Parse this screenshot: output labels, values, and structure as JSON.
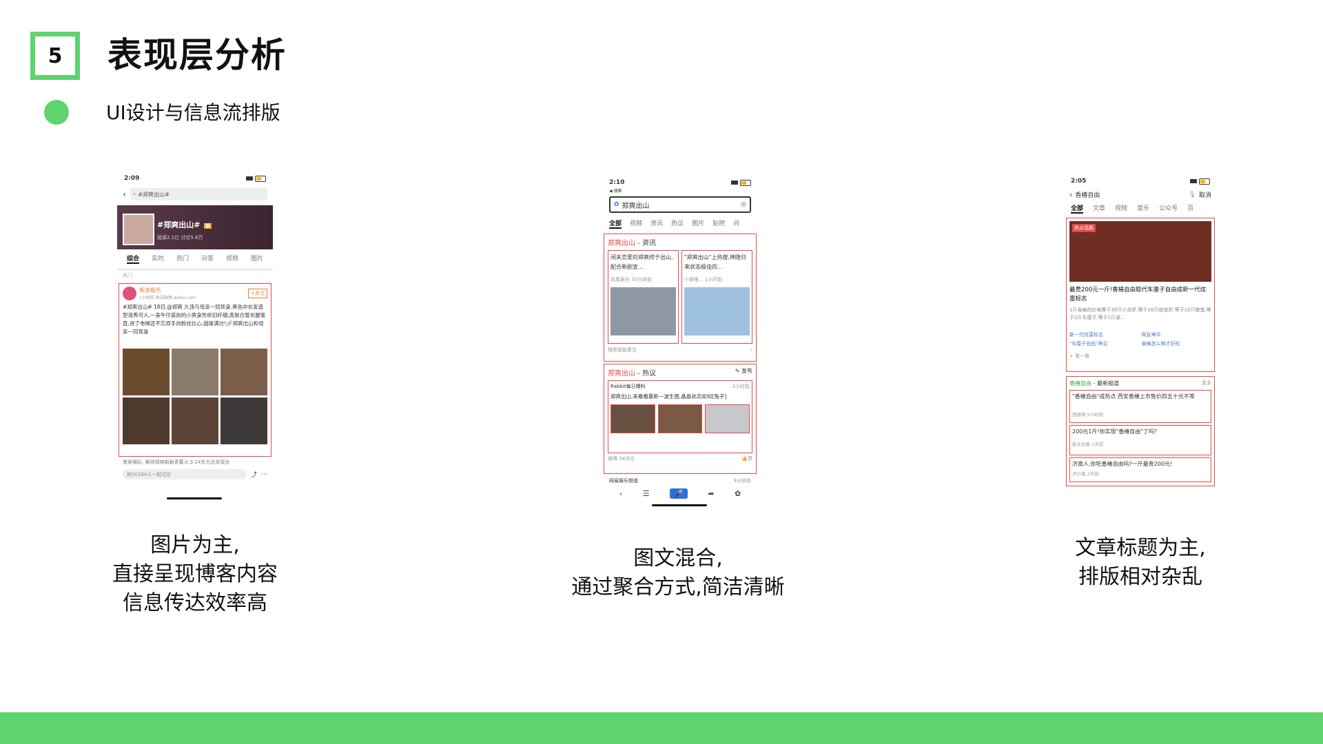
{
  "slide": {
    "number": "5",
    "title": "表现层分析",
    "subtitle": "UI设计与信息流排版"
  },
  "captions": {
    "left": [
      "图片为主,",
      "直接呈现博客内容",
      "信息传达效率高"
    ],
    "middle": [
      "图文混合,",
      "通过聚合方式,简洁清晰"
    ],
    "right": [
      "文章标题为主,",
      "排版相对杂乱"
    ]
  },
  "colors": {
    "accent": "#5fd36d",
    "highlight_red": "#e24a4a"
  },
  "phone_weibo": {
    "time": "2:09",
    "search": "#郑爽出山#",
    "topic_title": "#郑爽出山#",
    "topic_badge": "新",
    "topic_stats": "阅读2.1亿  讨论5.6万",
    "tabs": [
      "综合",
      "实时",
      "热门",
      "问答",
      "视频",
      "图片"
    ],
    "section": "热门",
    "poster": "新浪娱乐",
    "post_meta": "1小时前  来自微博 weibo.com",
    "follow": "+关注",
    "post_text": "#郑爽出山# 18日,@郑爽 久违与母亲一同现身,黑色中长发造型清秀可人,一身牛仔装扮的小爽身形依旧纤细,皮肤白皙长腿笔直,进了电梯还不忘双手向粉丝比心,甜度满分!🔗郑爽出山和母亲一同现身",
    "footer_line": "卷发喵砬: 期待郑爽新剧青春斗,3.24东方北京双台",
    "comment_placeholder": "和50184人一起讨论"
  },
  "phone_baidu": {
    "time": "2:10",
    "back_label": "◀ 搜索",
    "query": "郑爽出山",
    "tabs": [
      "全部",
      "视频",
      "资讯",
      "热议",
      "图片",
      "贴吧",
      "问"
    ],
    "news_title": "郑爽出山",
    "news_suffix": " - 资讯",
    "news_items": [
      {
        "title": "闭关恋爱的郑爽终于出山,配合新剧宣...",
        "source": "凤凰娱乐  35分钟前"
      },
      {
        "title": "\"郑爽出山\"上热搜,神隐归来状态极佳的...",
        "source": "小爱眼...  1小时前"
      }
    ],
    "news_more": "搜索智能聚合",
    "hot_title": "郑爽出山",
    "hot_suffix": " - 热议",
    "hot_publish": "发布",
    "hot_user": "Rabbit每日爆料",
    "hot_time": "2小时前",
    "hot_text": "郑爽出山,来看看最新一波生图,晶晶状态如何[兔子]",
    "hot_meta": "微博  58评论",
    "hot_like": "赞",
    "next_source": "网易娱乐频道",
    "next_time": "9分钟前"
  },
  "phone_wechat": {
    "time": "2:05",
    "query": "香椿自由",
    "cancel": "取消",
    "tabs": [
      "全部",
      "文章",
      "视频",
      "音乐",
      "公众号",
      "百"
    ],
    "hot_badge": "热点话题",
    "article_title": "最贵200元一斤!香椿自由取代车厘子自由成新一代炫富标志",
    "article_body": "1斤香椿的价格等于39只小龙虾,等于26只皮皮虾,等于10只鲍鱼,等于2斤车厘子,等于1斤波...",
    "related": [
      "新一代炫富标志",
      "网友神评",
      "\"车厘子自由\"再见",
      "香椿怎么做才好吃"
    ],
    "look_more": "看一看",
    "news_header": "香椿自由",
    "news_header_suffix": " - 最新报道",
    "more": "更多",
    "news": [
      {
        "title": "\"香椿自由\"成热点 西安香椿上市售价四五十元不等",
        "source": "西部网  5小时前"
      },
      {
        "title": "200元1斤!你实现\"香椿自由\"了吗?",
        "source": "新文化报  2天前"
      },
      {
        "title": "济南人,你吃香椿自由吗?一斤最贵200元!",
        "source": "济小南  2天前"
      }
    ]
  }
}
